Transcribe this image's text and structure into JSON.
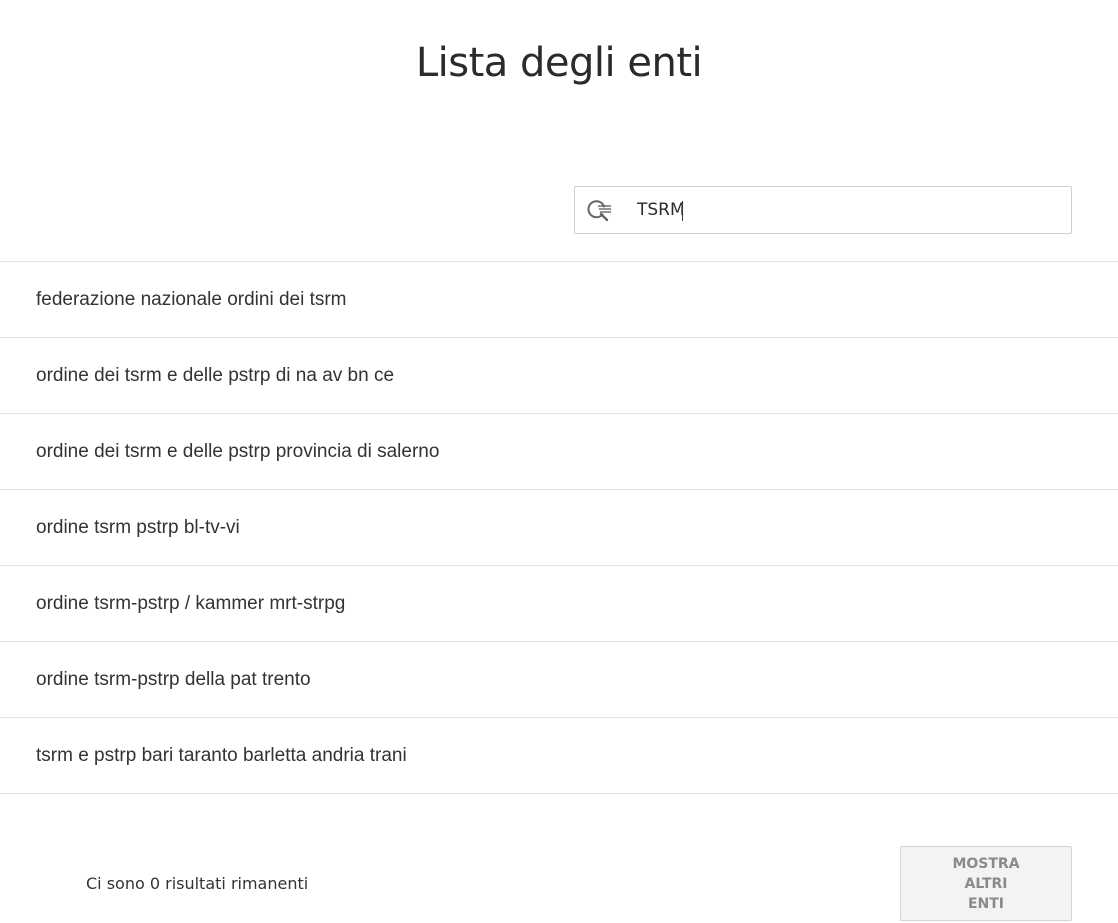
{
  "header": {
    "title": "Lista degli enti"
  },
  "search": {
    "value": "TSRM",
    "icon": "search-icon"
  },
  "results": [
    {
      "label": "federazione nazionale ordini dei tsrm"
    },
    {
      "label": "ordine dei tsrm e delle pstrp di na av bn ce"
    },
    {
      "label": "ordine dei tsrm e delle pstrp provincia di salerno"
    },
    {
      "label": "ordine tsrm pstrp bl-tv-vi"
    },
    {
      "label": "ordine tsrm-pstrp / kammer mrt-strpg"
    },
    {
      "label": "ordine tsrm-pstrp della pat trento"
    },
    {
      "label": "tsrm e pstrp bari taranto barletta andria trani"
    }
  ],
  "footer": {
    "remaining_text": "Ci sono 0 risultati rimanenti",
    "more_button_label": "MOSTRA ALTRI ENTI"
  },
  "colors": {
    "text": "#333333",
    "border": "#e3e3e3",
    "button_bg": "#f3f3f3",
    "button_text": "#8a8a8a"
  }
}
